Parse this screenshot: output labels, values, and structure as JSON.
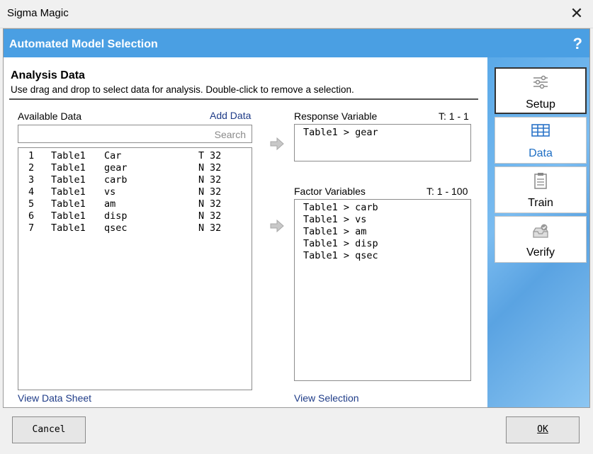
{
  "window": {
    "title": "Sigma Magic",
    "close_glyph": "✕"
  },
  "header": {
    "title": "Automated Model Selection",
    "help": "?"
  },
  "section": {
    "title": "Analysis Data",
    "description": "Use drag and drop to select data for analysis. Double-click to remove a selection."
  },
  "available": {
    "label": "Available Data",
    "add_link": "Add Data",
    "search_placeholder": "Search",
    "view_link": "View Data Sheet",
    "rows": [
      {
        "n": "1",
        "table": "Table1",
        "col": "Car",
        "type": "T",
        "count": "32"
      },
      {
        "n": "2",
        "table": "Table1",
        "col": "gear",
        "type": "N",
        "count": "32"
      },
      {
        "n": "3",
        "table": "Table1",
        "col": "carb",
        "type": "N",
        "count": "32"
      },
      {
        "n": "4",
        "table": "Table1",
        "col": "vs",
        "type": "N",
        "count": "32"
      },
      {
        "n": "5",
        "table": "Table1",
        "col": "am",
        "type": "N",
        "count": "32"
      },
      {
        "n": "6",
        "table": "Table1",
        "col": "disp",
        "type": "N",
        "count": "32"
      },
      {
        "n": "7",
        "table": "Table1",
        "col": "qsec",
        "type": "N",
        "count": "32"
      }
    ]
  },
  "response": {
    "label": "Response Variable",
    "range": "T: 1 - 1",
    "items": [
      "Table1 > gear"
    ]
  },
  "factors": {
    "label": "Factor Variables",
    "range": "T: 1 - 100",
    "items": [
      "Table1 > carb",
      "Table1 > vs",
      "Table1 > am",
      "Table1 > disp",
      "Table1 > qsec"
    ],
    "view_link": "View Selection"
  },
  "nav": {
    "setup": {
      "label": "Setup",
      "icon": "sliders-icon"
    },
    "data": {
      "label": "Data",
      "icon": "table-icon"
    },
    "train": {
      "label": "Train",
      "icon": "clipboard-icon"
    },
    "verify": {
      "label": "Verify",
      "icon": "inbox-check-icon"
    }
  },
  "footer": {
    "cancel": "Cancel",
    "ok": "OK"
  },
  "colors": {
    "header": "#4a9fe3",
    "link": "#1f3c88",
    "nav_selected": "#1f6fc4"
  }
}
